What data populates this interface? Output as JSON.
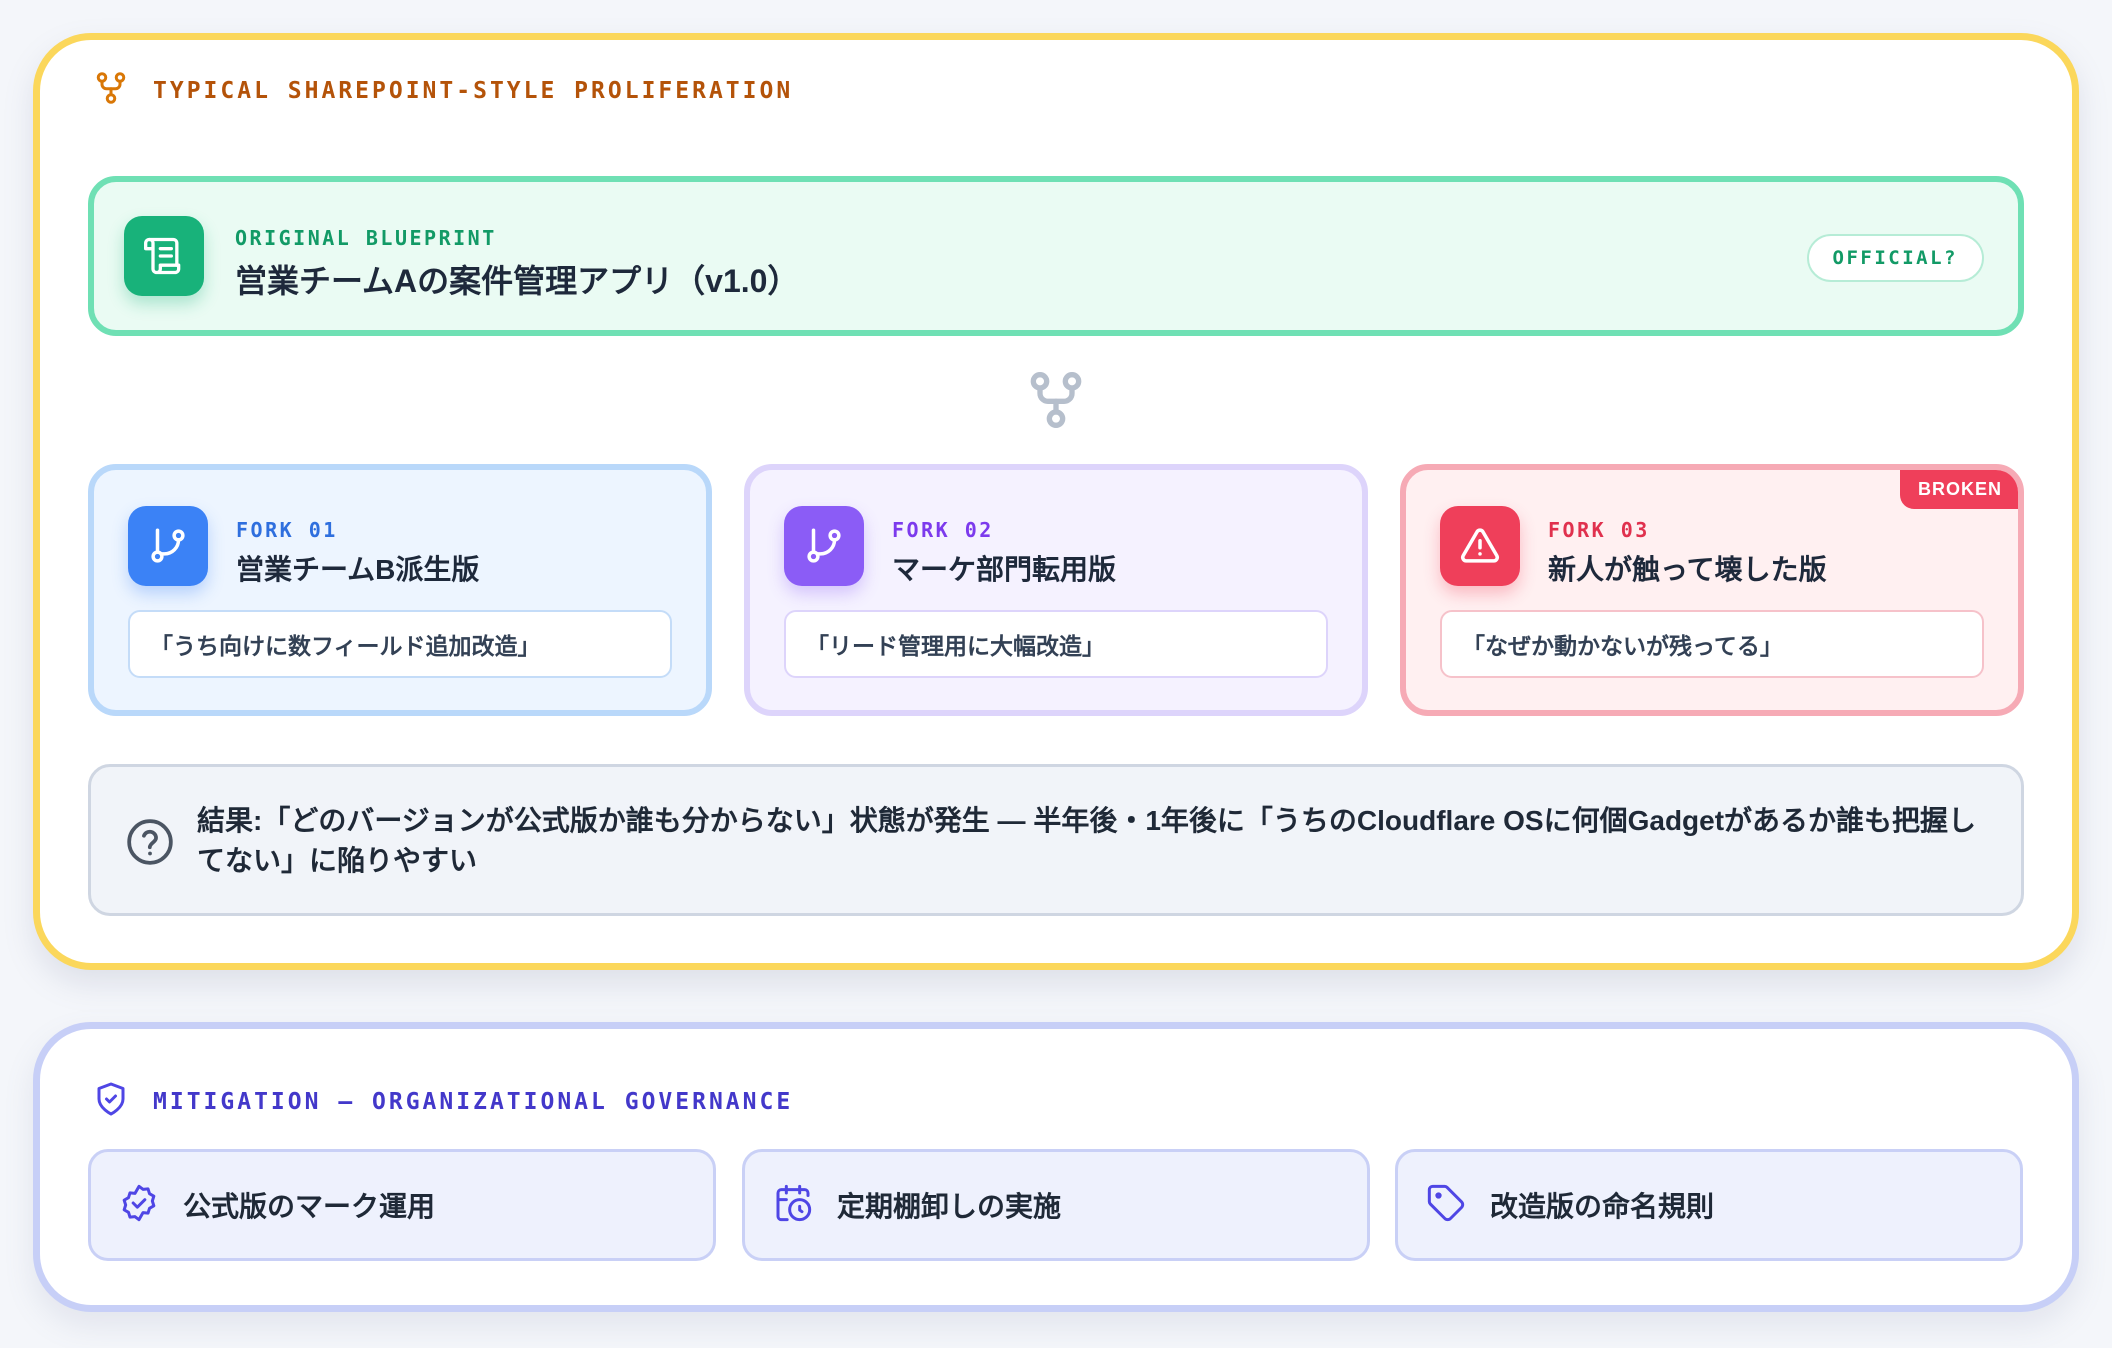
{
  "proliferation": {
    "heading": "TYPICAL SHAREPOINT-STYLE PROLIFERATION",
    "heading_color": "#b45309",
    "original": {
      "kicker": "ORIGINAL BLUEPRINT",
      "title": "営業チームAの案件管理アプリ（v1.0）",
      "badge": "OFFICIAL?",
      "icon": "scroll-icon",
      "color": "#18b27a"
    },
    "connector_icon": "git-fork-icon",
    "forks": [
      {
        "kicker": "FORK 01",
        "title": "営業チームB派生版",
        "quote": "「うち向けに数フィールド追加改造」",
        "icon": "git-branch-icon",
        "color": "#3b82f6"
      },
      {
        "kicker": "FORK 02",
        "title": "マーケ部門転用版",
        "quote": "「リード管理用に大幅改造」",
        "icon": "git-branch-icon",
        "color": "#8b5cf6"
      },
      {
        "kicker": "FORK 03",
        "title": "新人が触って壊した版",
        "quote": "「なぜか動かないが残ってる」",
        "icon": "warning-triangle-icon",
        "color": "#ef3f5a",
        "tag": "BROKEN"
      }
    ],
    "result": {
      "icon": "question-circle-icon",
      "text": "結果:「どのバージョンが公式版か誰も分からない」状態が発生 — 半年後・1年後に「うちのCloudflare OSに何個Gadgetがあるか誰も把握してない」に陥りやすい"
    }
  },
  "mitigation": {
    "heading": "MITIGATION — ORGANIZATIONAL GOVERNANCE",
    "heading_color": "#4338ca",
    "icon": "shield-check-icon",
    "items": [
      {
        "label": "公式版のマーク運用",
        "icon": "badge-check-icon"
      },
      {
        "label": "定期棚卸しの実施",
        "icon": "calendar-clock-icon"
      },
      {
        "label": "改造版の命名規則",
        "icon": "tag-icon"
      }
    ]
  }
}
